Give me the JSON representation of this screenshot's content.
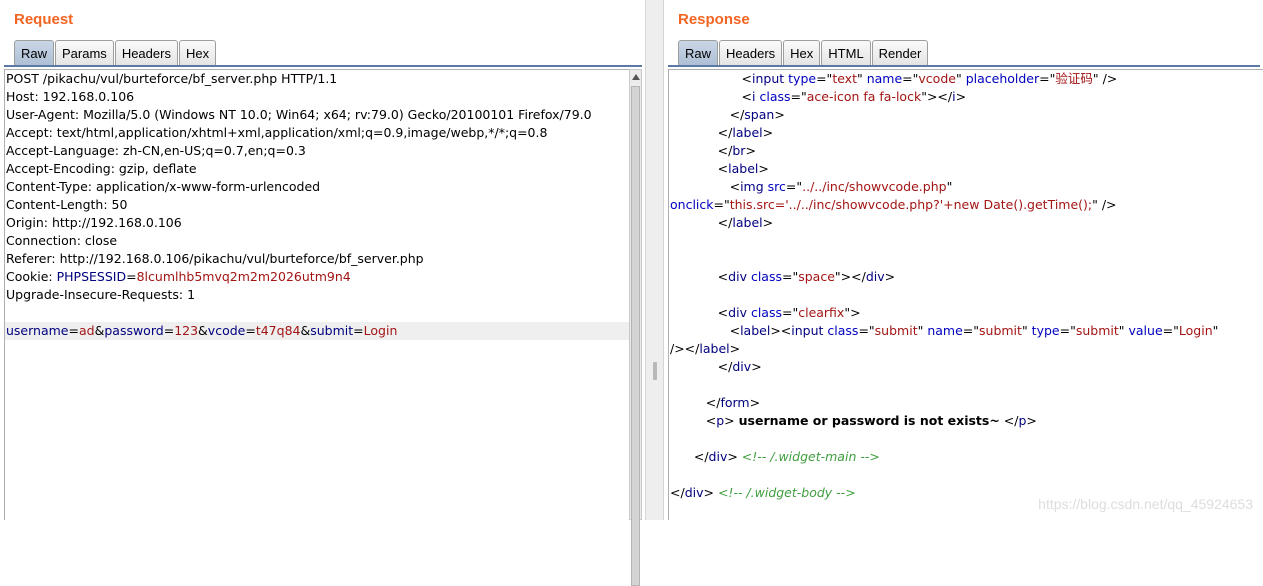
{
  "request": {
    "title": "Request",
    "tabs": [
      "Raw",
      "Params",
      "Headers",
      "Hex"
    ],
    "active_tab": "Raw",
    "lines": [
      "POST /pikachu/vul/burteforce/bf_server.php HTTP/1.1",
      "Host: 192.168.0.106",
      "User-Agent: Mozilla/5.0 (Windows NT 10.0; Win64; x64; rv:79.0) Gecko/20100101 Firefox/79.0",
      "Accept: text/html,application/xhtml+xml,application/xml;q=0.9,image/webp,*/*;q=0.8",
      "Accept-Language: zh-CN,en-US;q=0.7,en;q=0.3",
      "Accept-Encoding: gzip, deflate",
      "Content-Type: application/x-www-form-urlencoded",
      "Content-Length: 50",
      "Origin: http://192.168.0.106",
      "Connection: close",
      "Referer: http://192.168.0.106/pikachu/vul/burteforce/bf_server.php"
    ],
    "cookie": {
      "label": "Cookie: ",
      "name": "PHPSESSID",
      "eq": "=",
      "value": "8lcumlhb5mvq2m2m2026utm9n4"
    },
    "upgrade_line": "Upgrade-Insecure-Requests: 1",
    "body": [
      {
        "name": "username",
        "value": "ad"
      },
      {
        "name": "password",
        "value": "123"
      },
      {
        "name": "vcode",
        "value": "t47q84"
      },
      {
        "name": "submit",
        "value": "Login"
      }
    ]
  },
  "response": {
    "title": "Response",
    "tabs": [
      "Raw",
      "Headers",
      "Hex",
      "HTML",
      "Render"
    ],
    "active_tab": "Raw",
    "html": {
      "input_vcode": {
        "tag": "input",
        "type": "text",
        "name": "vcode",
        "placeholder": "验证码"
      },
      "icon": {
        "tag": "i",
        "class": "ace-icon fa fa-lock"
      },
      "span_close": "span",
      "label_close": "label",
      "br_close": "br",
      "label_open": "label",
      "img": {
        "tag": "img",
        "src": "../../inc/showvcode.php",
        "onclick": "this.src='../../inc/showvcode.php?'+new Date().getTime();"
      },
      "div_space": "space",
      "div_clearfix": "clearfix",
      "submit_input": {
        "class": "submit",
        "name": "submit",
        "type": "submit",
        "value": "Login"
      },
      "form_close": "form",
      "message": "username or password is not exists~",
      "comment_main": "<!-- /.widget-main -->",
      "comment_body": "<!-- /.widget-body -->"
    }
  },
  "watermark": "https://blog.csdn.net/qq_45924653"
}
